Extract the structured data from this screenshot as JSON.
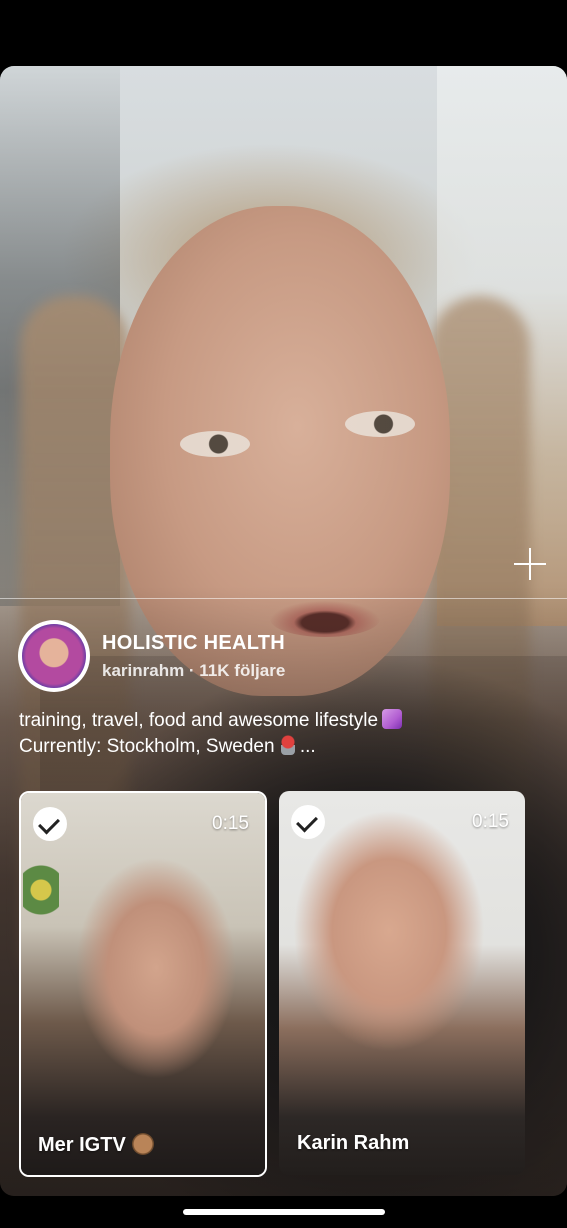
{
  "channel": {
    "title": "HOLISTIC HEALTH",
    "meta": "karinrahm · 11K följare",
    "bio_line1": "training, travel, food and awesome lifestyle",
    "bio_line2": "Currently: Stockholm, Sweden",
    "bio_more": "..."
  },
  "icons": {
    "add": "plus-icon",
    "unicorn": "unicorn-emoji",
    "pin": "round-pushpin-emoji",
    "monkey": "see-no-evil-monkey-emoji"
  },
  "episodes": [
    {
      "title": "Mer IGTV",
      "duration": "0:15",
      "selected": true
    },
    {
      "title": "Karin Rahm",
      "duration": "0:15",
      "selected": true
    }
  ],
  "colors": {
    "background": "#000000",
    "text": "#ffffff"
  }
}
